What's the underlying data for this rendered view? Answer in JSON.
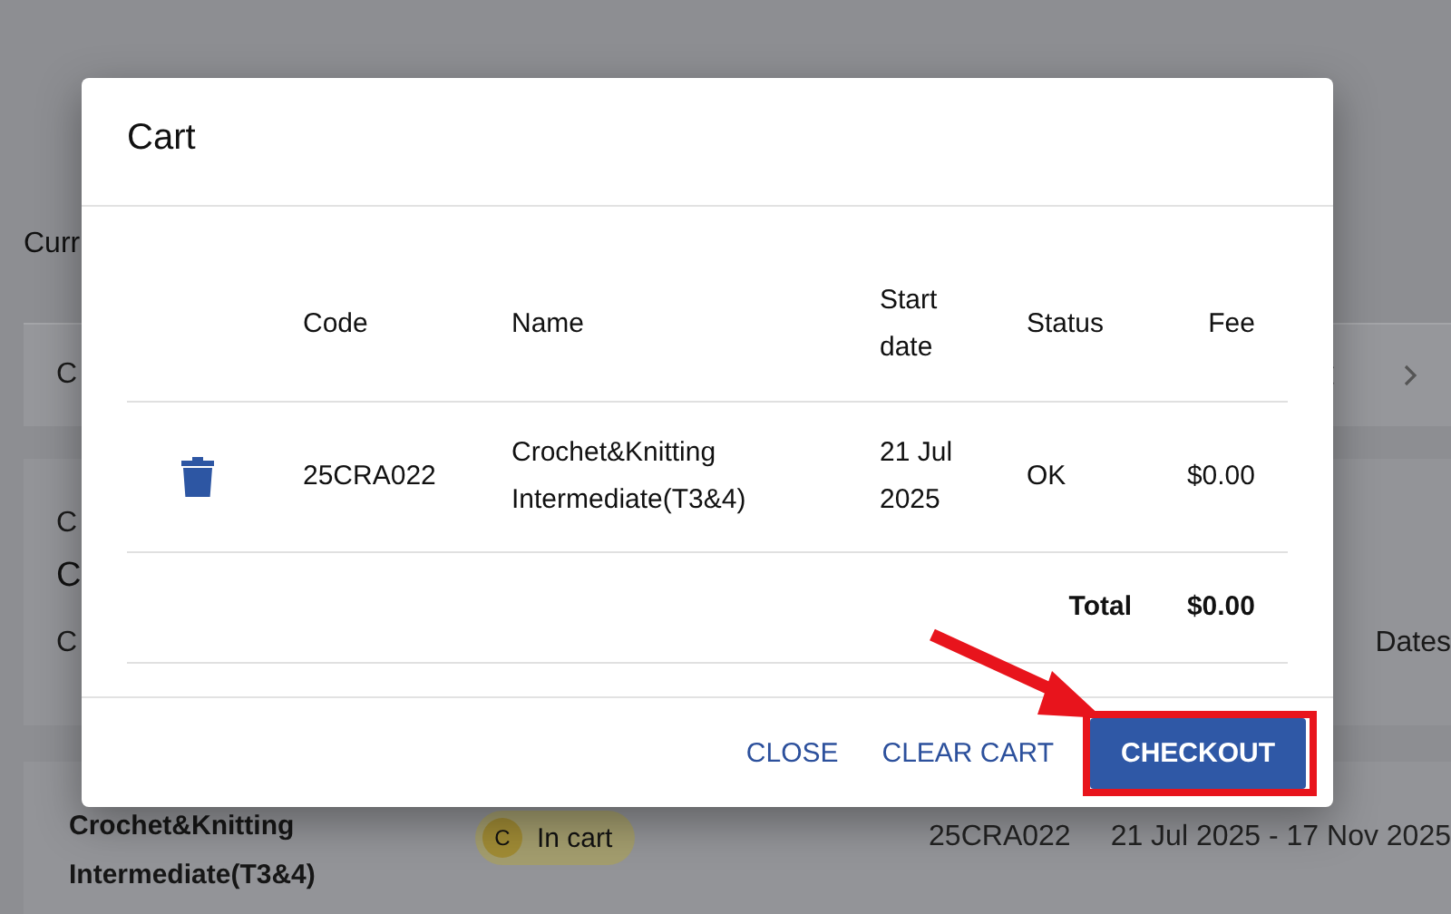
{
  "background": {
    "subtitle": "Curr",
    "tabs_bar": {
      "label": "C"
    },
    "card": {
      "line_1": "C",
      "line_2": "C",
      "line_3": "C",
      "column_dates": "Dates"
    },
    "course_row": {
      "name": "Crochet&Knitting Intermediate(T3&4)",
      "status_initial": "C",
      "status": "In cart",
      "code": "25CRA022",
      "dates": "21 Jul 2025 - 17 Nov 2025"
    }
  },
  "dialog": {
    "title": "Cart",
    "columns": [
      "Code",
      "Name",
      "Start date",
      "Status",
      "Fee"
    ],
    "rows": [
      {
        "code": "25CRA022",
        "name": "Crochet&Knitting Intermediate(T3&4)",
        "start_date": "21 Jul 2025",
        "status": "OK",
        "fee": "$0.00"
      }
    ],
    "total_label": "Total",
    "total": "$0.00",
    "buttons": [
      {
        "label": "CLOSE",
        "kind": "text",
        "highlighted": false
      },
      {
        "label": "CLEAR CART",
        "kind": "text",
        "highlighted": false
      },
      {
        "label": "CHECKOUT",
        "kind": "primary",
        "highlighted": true
      }
    ]
  }
}
